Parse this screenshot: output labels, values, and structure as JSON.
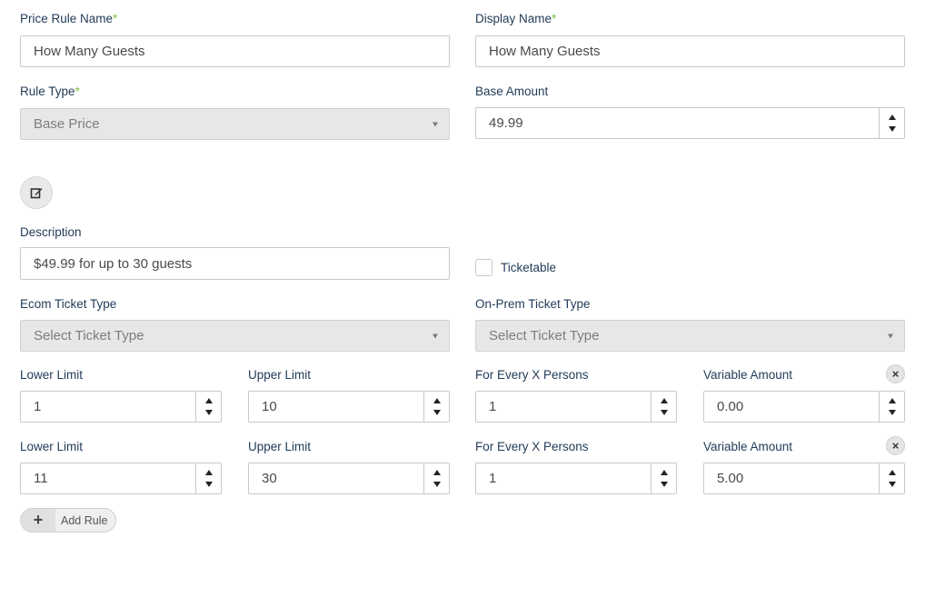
{
  "price_rule_name": {
    "label": "Price Rule Name",
    "required_mark": "*",
    "value": "How Many Guests"
  },
  "display_name": {
    "label": "Display Name",
    "required_mark": "*",
    "value": "How Many Guests"
  },
  "rule_type": {
    "label": "Rule Type",
    "required_mark": "*",
    "value": "Base Price"
  },
  "base_amount": {
    "label": "Base Amount",
    "value": "49.99"
  },
  "description": {
    "label": "Description",
    "value": "$49.99 for up to 30 guests"
  },
  "ticketable": {
    "label": "Ticketable",
    "checked": false
  },
  "ecom_ticket_type": {
    "label": "Ecom Ticket Type",
    "placeholder": "Select Ticket Type"
  },
  "onprem_ticket_type": {
    "label": "On-Prem Ticket Type",
    "placeholder": "Select Ticket Type"
  },
  "rules": [
    {
      "lower_limit_label": "Lower Limit",
      "lower_limit": "1",
      "upper_limit_label": "Upper Limit",
      "upper_limit": "10",
      "every_x_label": "For Every X Persons",
      "every_x": "1",
      "variable_amount_label": "Variable Amount",
      "variable_amount": "0.00"
    },
    {
      "lower_limit_label": "Lower Limit",
      "lower_limit": "11",
      "upper_limit_label": "Upper Limit",
      "upper_limit": "30",
      "every_x_label": "For Every X Persons",
      "every_x": "1",
      "variable_amount_label": "Variable Amount",
      "variable_amount": "5.00"
    }
  ],
  "add_rule": {
    "icon": "+",
    "label": "Add Rule"
  },
  "icons": {
    "edit": "edit-icon",
    "remove": "close-icon",
    "spinner": "spinner-arrows-icon",
    "select": "caret-down-icon"
  },
  "colors": {
    "label": "#1f3a57",
    "required": "#7cc243",
    "disabled_bg": "#e7e7e7",
    "border": "#c9c9c9"
  }
}
